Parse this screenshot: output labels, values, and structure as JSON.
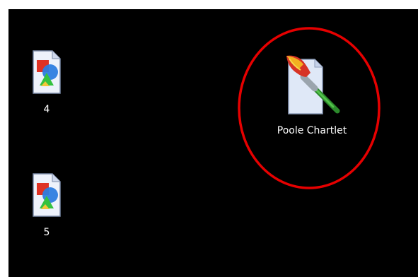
{
  "desktop": {
    "background_color": "#000000",
    "icons": [
      {
        "label": "4",
        "icon": "image-file-icon"
      },
      {
        "label": "5",
        "icon": "image-file-icon"
      },
      {
        "label": "Poole Chartlet",
        "icon": "paint-file-icon"
      }
    ]
  },
  "annotation": {
    "shape": "ellipse",
    "color": "#e60000"
  }
}
